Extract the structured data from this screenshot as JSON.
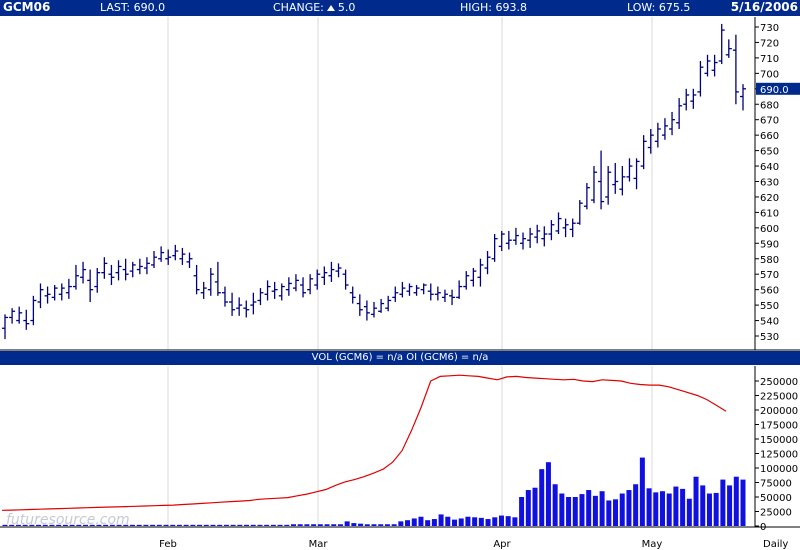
{
  "header": {
    "symbol": "GCM06",
    "last": "LAST: 690.0",
    "change_label": "CHANGE:",
    "change_value": "5.0",
    "high": "HIGH: 693.8",
    "low": "LOW: 675.5",
    "date": "5/16/2006"
  },
  "volume_header": "VOL (GCM6) = n/a OI (GCM6) = n/a",
  "watermark": "futuresource.com",
  "last_price_label": "690.0",
  "colors": {
    "header_bg": "#002a8c",
    "price_bars": "#000080",
    "volume_bars": "#1010e0",
    "open_interest": "#e00000",
    "last_tag": "#002a8c",
    "grid": "#d8d8d8"
  },
  "chart_data": [
    {
      "type": "ohlc",
      "name": "GCM06",
      "x_labels": [
        "Feb",
        "Mar",
        "Apr",
        "May",
        "Daily"
      ],
      "ylim": [
        525,
        735
      ],
      "y_ticks": [
        530,
        540,
        550,
        560,
        570,
        580,
        590,
        600,
        610,
        620,
        630,
        640,
        650,
        660,
        670,
        680,
        690,
        700,
        710,
        720,
        730
      ],
      "grid": true,
      "bars": [
        [
          535,
          544,
          528,
          542
        ],
        [
          542,
          548,
          538,
          546
        ],
        [
          540,
          549,
          538,
          545
        ],
        [
          540,
          547,
          534,
          538
        ],
        [
          540,
          556,
          537,
          553
        ],
        [
          552,
          564,
          548,
          560
        ],
        [
          556,
          562,
          551,
          557
        ],
        [
          555,
          563,
          553,
          561
        ],
        [
          557,
          564,
          553,
          561
        ],
        [
          558,
          567,
          554,
          562
        ],
        [
          562,
          576,
          560,
          569
        ],
        [
          568,
          578,
          564,
          573
        ],
        [
          566,
          573,
          552,
          560
        ],
        [
          562,
          574,
          558,
          571
        ],
        [
          571,
          581,
          567,
          577
        ],
        [
          570,
          576,
          563,
          568
        ],
        [
          571,
          579,
          566,
          575
        ],
        [
          573,
          580,
          566,
          570
        ],
        [
          572,
          578,
          568,
          576
        ],
        [
          573,
          580,
          570,
          575
        ],
        [
          574,
          581,
          570,
          577
        ],
        [
          576,
          585,
          574,
          581
        ],
        [
          580,
          588,
          578,
          584
        ],
        [
          580,
          586,
          576,
          581
        ],
        [
          582,
          589,
          579,
          585
        ],
        [
          580,
          587,
          576,
          583
        ],
        [
          578,
          584,
          574,
          580
        ],
        [
          569,
          576,
          557,
          560
        ],
        [
          558,
          565,
          554,
          561
        ],
        [
          560,
          574,
          556,
          570
        ],
        [
          565,
          578,
          556,
          558
        ],
        [
          558,
          562,
          549,
          552
        ],
        [
          552,
          558,
          543,
          547
        ],
        [
          548,
          555,
          543,
          550
        ],
        [
          548,
          553,
          542,
          547
        ],
        [
          550,
          558,
          544,
          552
        ],
        [
          553,
          561,
          550,
          558
        ],
        [
          557,
          566,
          553,
          562
        ],
        [
          559,
          565,
          554,
          560
        ],
        [
          556,
          564,
          553,
          562
        ],
        [
          560,
          568,
          556,
          564
        ],
        [
          561,
          570,
          559,
          566
        ],
        [
          563,
          568,
          555,
          558
        ],
        [
          560,
          570,
          557,
          567
        ],
        [
          563,
          573,
          560,
          570
        ],
        [
          568,
          575,
          563,
          571
        ],
        [
          569,
          578,
          565,
          573
        ],
        [
          572,
          577,
          568,
          574
        ],
        [
          570,
          573,
          560,
          563
        ],
        [
          558,
          562,
          551,
          555
        ],
        [
          551,
          557,
          543,
          547
        ],
        [
          549,
          553,
          540,
          545
        ],
        [
          544,
          552,
          542,
          548
        ],
        [
          546,
          554,
          545,
          551
        ],
        [
          548,
          556,
          546,
          553
        ],
        [
          555,
          562,
          552,
          558
        ],
        [
          557,
          565,
          555,
          561
        ],
        [
          559,
          564,
          556,
          562
        ],
        [
          558,
          563,
          556,
          561
        ],
        [
          560,
          564,
          557,
          563
        ],
        [
          559,
          564,
          553,
          557
        ],
        [
          557,
          562,
          553,
          558
        ],
        [
          555,
          560,
          552,
          557
        ],
        [
          556,
          560,
          550,
          555
        ],
        [
          555,
          566,
          554,
          562
        ],
        [
          562,
          572,
          560,
          569
        ],
        [
          566,
          574,
          562,
          572
        ],
        [
          568,
          580,
          562,
          576
        ],
        [
          574,
          585,
          570,
          581
        ],
        [
          580,
          596,
          578,
          593
        ],
        [
          588,
          598,
          585,
          596
        ],
        [
          590,
          598,
          586,
          592
        ],
        [
          592,
          600,
          589,
          595
        ],
        [
          590,
          597,
          586,
          593
        ],
        [
          592,
          600,
          587,
          596
        ],
        [
          594,
          602,
          590,
          598
        ],
        [
          593,
          601,
          588,
          596
        ],
        [
          596,
          605,
          592,
          602
        ],
        [
          598,
          610,
          596,
          606
        ],
        [
          600,
          606,
          594,
          602
        ],
        [
          599,
          606,
          594,
          603
        ],
        [
          603,
          618,
          602,
          616
        ],
        [
          614,
          629,
          612,
          626
        ],
        [
          618,
          640,
          616,
          636
        ],
        [
          630,
          650,
          612,
          617
        ],
        [
          620,
          640,
          615,
          636
        ],
        [
          628,
          642,
          622,
          630
        ],
        [
          625,
          640,
          621,
          633
        ],
        [
          633,
          645,
          630,
          640
        ],
        [
          632,
          645,
          625,
          643
        ],
        [
          640,
          660,
          638,
          656
        ],
        [
          652,
          664,
          648,
          660
        ],
        [
          656,
          668,
          652,
          664
        ],
        [
          660,
          671,
          657,
          666
        ],
        [
          664,
          675,
          660,
          670
        ],
        [
          668,
          684,
          664,
          679
        ],
        [
          680,
          690,
          676,
          686
        ],
        [
          682,
          690,
          677,
          686
        ],
        [
          688,
          708,
          685,
          704
        ],
        [
          700,
          712,
          698,
          708
        ],
        [
          702,
          712,
          698,
          707
        ],
        [
          708,
          732,
          706,
          728
        ],
        [
          712,
          722,
          710,
          716
        ],
        [
          715,
          725,
          680,
          688
        ],
        [
          685,
          693,
          676,
          690
        ]
      ]
    },
    {
      "type": "bar+line",
      "series": [
        {
          "name": "VOL",
          "type": "bar",
          "values": [
            2000,
            2000,
            2000,
            2000,
            2000,
            2000,
            2000,
            2000,
            2000,
            2000,
            2000,
            2000,
            2000,
            2000,
            2000,
            2000,
            2000,
            2000,
            2000,
            2000,
            2000,
            2000,
            2000,
            2000,
            2000,
            2000,
            2000,
            2000,
            2000,
            2000,
            2000,
            2000,
            2000,
            2000,
            2000,
            2000,
            2000,
            2000,
            2000,
            2000,
            2000,
            2000,
            2000,
            3000,
            3000,
            3000,
            3000,
            3000,
            3000,
            3000,
            3000,
            8000,
            5000,
            4000,
            3000,
            3000,
            3000,
            3000,
            3000,
            8000,
            10000,
            13000,
            16000,
            10000,
            12000,
            20000,
            16000,
            11000,
            13000,
            16000,
            15000,
            14000,
            12000,
            15000,
            18000,
            17000,
            15000,
            50000,
            62000,
            66000,
            98000,
            110000,
            72000,
            56000,
            50000,
            50000,
            55000,
            62000,
            52000,
            60000,
            44000,
            46000,
            56000,
            62000,
            72000,
            118000,
            65000,
            58000,
            60000,
            56000,
            68000,
            64000,
            47000,
            85000,
            70000,
            56000,
            57000,
            80000,
            70000,
            85000,
            80000
          ]
        },
        {
          "name": "OI",
          "type": "line",
          "values": [
            27000,
            27500,
            28000,
            28500,
            29000,
            29500,
            30000,
            30500,
            31000,
            31500,
            32000,
            32500,
            33000,
            33500,
            34000,
            34500,
            35000,
            35500,
            36000,
            37000,
            38000,
            39000,
            40000,
            41000,
            42000,
            43000,
            44000,
            46000,
            47000,
            48000,
            49000,
            52000,
            55000,
            59000,
            63000,
            70000,
            76000,
            80000,
            85000,
            91000,
            98000,
            110000,
            130000,
            165000,
            205000,
            250000,
            258000,
            259000,
            260000,
            259000,
            258000,
            255000,
            252000,
            257000,
            258000,
            256000,
            255000,
            254000,
            253000,
            252000,
            253000,
            250000,
            249000,
            252000,
            251000,
            250000,
            246000,
            244000,
            243000,
            243000,
            240000,
            235000,
            230000,
            225000,
            218000,
            208000,
            198000
          ]
        }
      ],
      "ylim": [
        0,
        265000
      ],
      "y_ticks": [
        0,
        25000,
        50000,
        75000,
        100000,
        125000,
        150000,
        175000,
        200000,
        225000,
        250000
      ]
    }
  ]
}
